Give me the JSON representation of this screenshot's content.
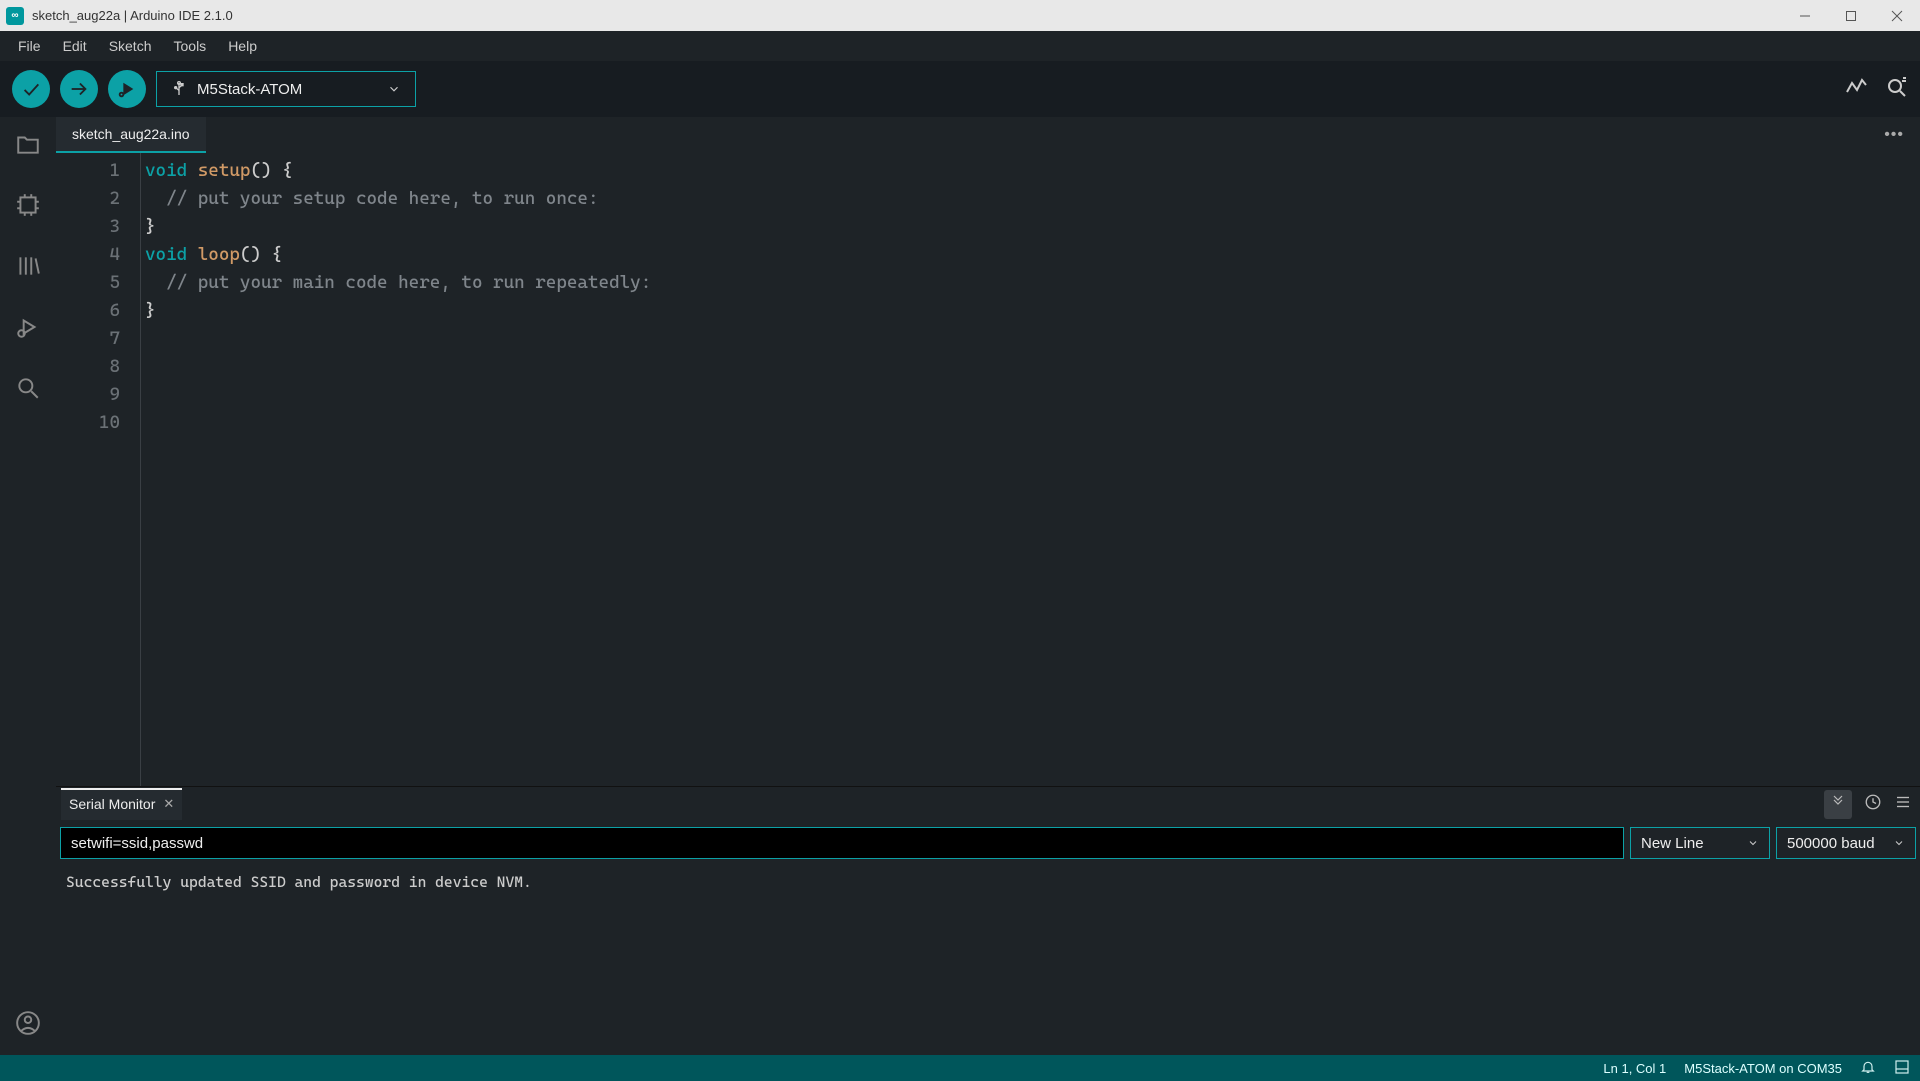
{
  "title": "sketch_aug22a | Arduino IDE 2.1.0",
  "menu": {
    "file": "File",
    "edit": "Edit",
    "sketch": "Sketch",
    "tools": "Tools",
    "help": "Help"
  },
  "toolbar": {
    "board": "M5Stack-ATOM"
  },
  "tab": {
    "name": "sketch_aug22a.ino"
  },
  "code": {
    "lines": [
      "1",
      "2",
      "3",
      "4",
      "5",
      "6",
      "7",
      "8",
      "9",
      "10"
    ],
    "l1_kw": "void",
    "l1_fn": "setup",
    "l1_rest": "() {",
    "l2": "  // put your setup code here, to run once:",
    "l3": "",
    "l4": "}",
    "l5": "",
    "l6_kw": "void",
    "l6_fn": "loop",
    "l6_rest": "() {",
    "l7": "  // put your main code here, to run repeatedly:",
    "l8": "",
    "l9": "}",
    "l10": ""
  },
  "panel": {
    "tab": "Serial Monitor"
  },
  "serial": {
    "input": "setwifi=ssid,passwd",
    "lineEnding": "New Line",
    "baud": "500000 baud",
    "output": "Successfully updated SSID and password in device NVM."
  },
  "status": {
    "cursor": "Ln 1, Col 1",
    "board": "M5Stack-ATOM on COM35"
  }
}
